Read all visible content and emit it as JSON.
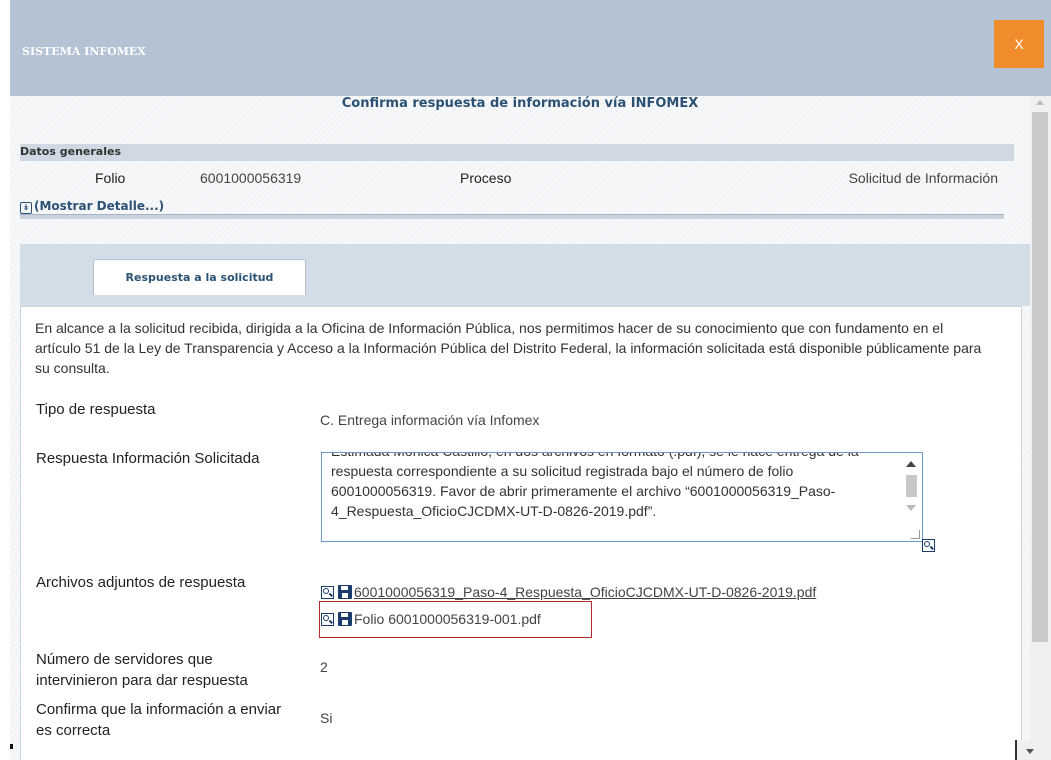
{
  "window": {
    "title": "SISTEMA INFOMEX",
    "close_label": "X"
  },
  "heading": "Confirma respuesta de información vía INFOMEX",
  "datos_generales": {
    "title": "Datos generales",
    "folio_label": "Folio",
    "folio_value": "6001000056319",
    "proceso_label": "Proceso",
    "proceso_value": "Solicitud de Información",
    "detail_link": "(Mostrar Detalle...)"
  },
  "tabs": [
    {
      "label": "Respuesta a la solicitud"
    }
  ],
  "intro": "En alcance a la solicitud recibida, dirigida a la Oficina de Información Pública, nos permitimos hacer de su conocimiento que con fundamento en el artículo 51 de la Ley de Transparencia y Acceso a la Información Pública del Distrito Federal, la información solicitada está disponible públicamente para su consulta.",
  "fields": {
    "tipo_label": "Tipo de respuesta",
    "tipo_value": "C. Entrega información vía Infomex",
    "respuesta_label": "Respuesta Información Solicitada",
    "respuesta_value": "Estimada Mónica Castillo, en dos archivos en formato (.pdf), se le hace entrega de la respuesta correspondiente a su solicitud registrada bajo el número de folio 6001000056319. Favor de abrir primeramente el archivo “6001000056319_Paso-4_Respuesta_OficioCJCDMX-UT-D-0826-2019.pdf”.",
    "archivos_label": "Archivos adjuntos de respuesta",
    "archivos": [
      {
        "name": "6001000056319_Paso-4_Respuesta_OficioCJCDMX-UT-D-0826-2019.pdf"
      },
      {
        "name": "Folio 6001000056319-001.pdf"
      }
    ],
    "servidores_label": "Número de servidores que intervinieron para dar respuesta",
    "servidores_value": "2",
    "confirma_label": "Confirma que la información a enviar es correcta",
    "confirma_value": "Si"
  },
  "colors": {
    "titlebar": "#b3c3d4",
    "close_button": "#f08c2c",
    "heading": "#2b5274",
    "highlight": "#b5282e"
  }
}
